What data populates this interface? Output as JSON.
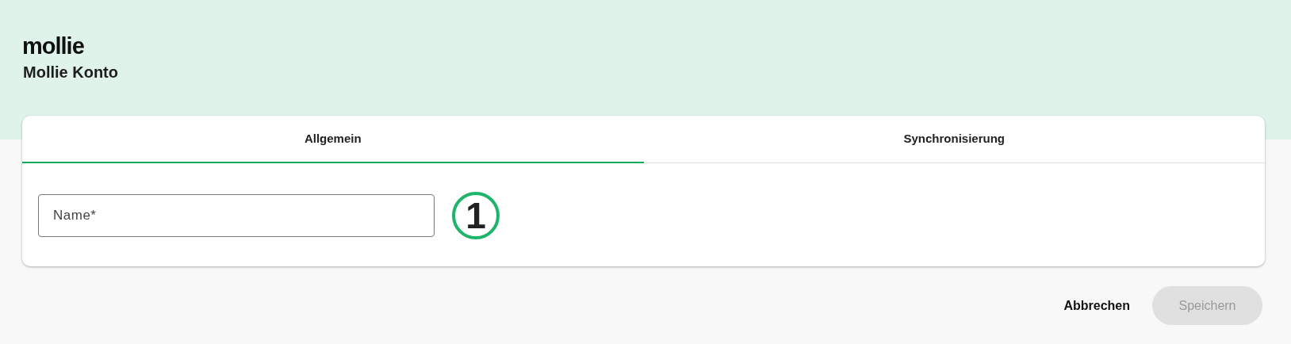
{
  "header": {
    "logo": "mollie",
    "title": "Mollie Konto"
  },
  "tabs": [
    {
      "label": "Allgemein",
      "selected": true
    },
    {
      "label": "Synchronisierung",
      "selected": false
    }
  ],
  "fields": [
    {
      "placeholder": "Name*",
      "marker": "1"
    }
  ],
  "buttons": [
    {
      "label": "Abbrechen",
      "kind": "text",
      "disabled": false
    },
    {
      "label": "Speichern",
      "kind": "filled",
      "disabled": true
    }
  ]
}
